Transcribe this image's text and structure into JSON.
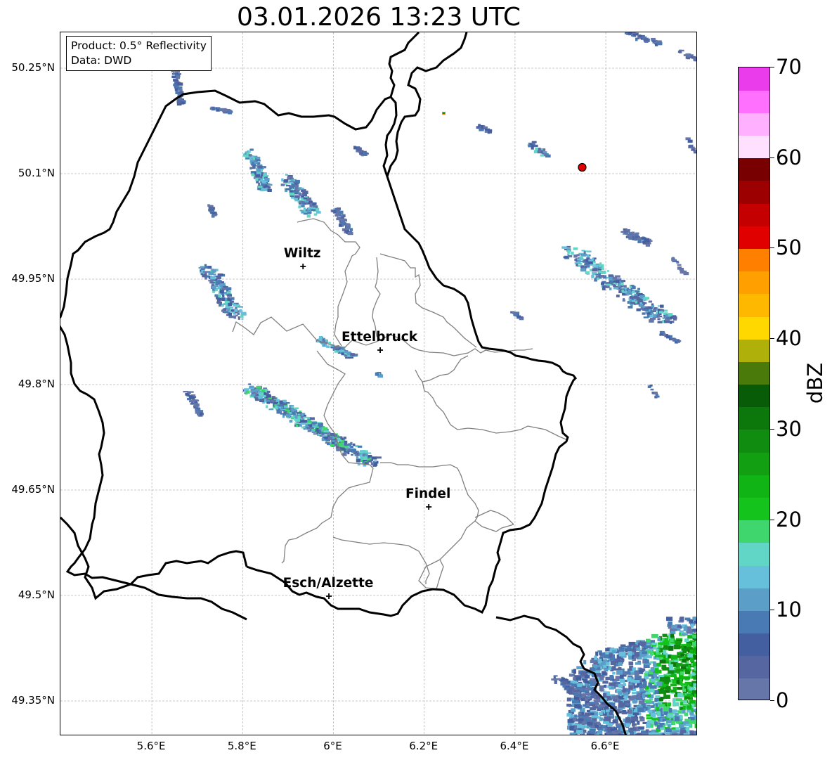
{
  "title": "03.01.2026 13:23 UTC",
  "info": {
    "product": "Product: 0.5° Reflectivity",
    "data": "Data: DWD"
  },
  "latitude_labels": [
    "50.25°N",
    "50.1°N",
    "49.95°N",
    "49.8°N",
    "49.65°N",
    "49.5°N",
    "49.35°N"
  ],
  "longitude_labels": [
    "5.6°E",
    "5.8°E",
    "6°E",
    "6.2°E",
    "6.4°E",
    "6.6°E"
  ],
  "latitudes": [
    50.25,
    50.1,
    49.95,
    49.8,
    49.65,
    49.5,
    49.35
  ],
  "longitudes": [
    5.6,
    5.8,
    6.0,
    6.2,
    6.4,
    6.6
  ],
  "cities": [
    {
      "name": "Wiltz",
      "lon": 5.933,
      "lat": 49.968
    },
    {
      "name": "Ettelbruck",
      "lon": 6.103,
      "lat": 49.849
    },
    {
      "name": "Findel",
      "lon": 6.21,
      "lat": 49.626
    },
    {
      "name": "Esch/Alzette",
      "lon": 5.99,
      "lat": 49.499
    }
  ],
  "radar_site": {
    "lon": 6.548,
    "lat": 50.109,
    "color": "#e00000"
  },
  "colorbar": {
    "label": "dBZ",
    "ticks": [
      "0",
      "10",
      "20",
      "30",
      "40",
      "50",
      "60",
      "70"
    ],
    "min": 0,
    "max": 70,
    "step": 2.5,
    "colors": [
      "#6676a8",
      "#5566a0",
      "#445fa0",
      "#4a7ab4",
      "#5b9fc8",
      "#66c0dc",
      "#62d6c6",
      "#3fd66e",
      "#14c41c",
      "#10b414",
      "#12a012",
      "#108c10",
      "#0c780c",
      "#085c08",
      "#4a7a0a",
      "#b0b00a",
      "#ffd800",
      "#ffb800",
      "#ffa000",
      "#ff7f00",
      "#e00000",
      "#c40000",
      "#9c0000",
      "#780000",
      "#ffe0ff",
      "#ffb0ff",
      "#ff70ff",
      "#ea3cea"
    ]
  },
  "map_extent": {
    "lon_min": 5.4,
    "lon_max": 6.8,
    "lat_min": 49.3,
    "lat_max": 50.3
  }
}
